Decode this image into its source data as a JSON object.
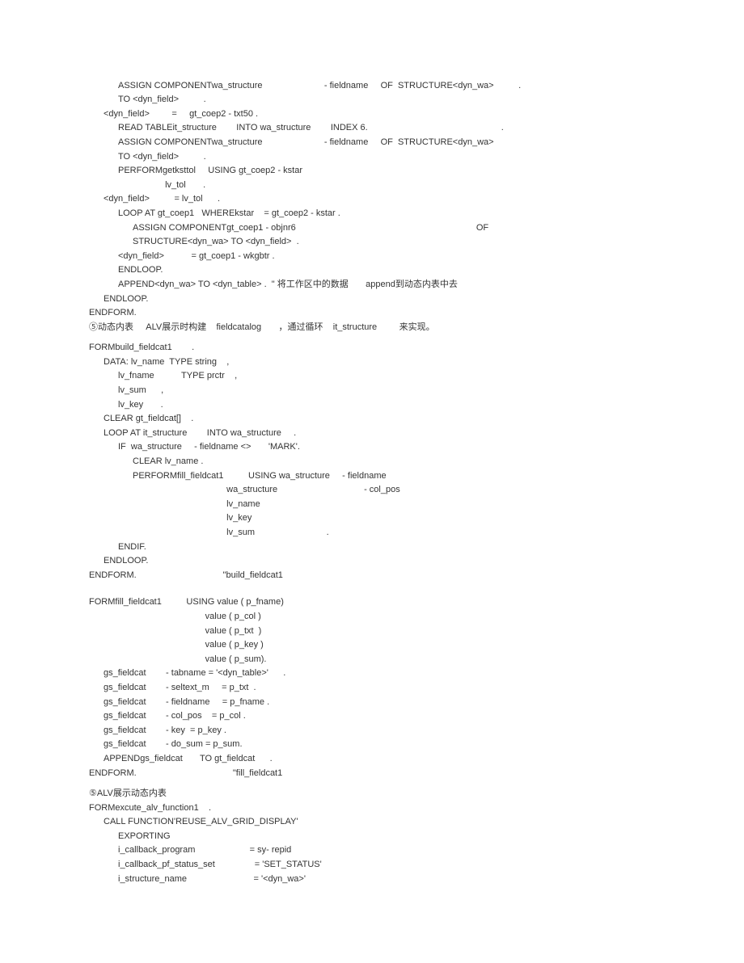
{
  "lines": [
    {
      "indent": 2,
      "text": "ASSIGN COMPONENTwa_structure                         - fieldname     OF  STRUCTURE<dyn_wa>          ."
    },
    {
      "indent": 2,
      "text": "TO <dyn_field>          ."
    },
    {
      "indent": 1,
      "text": "<dyn_field>         =     gt_coep2 - txt50 ."
    },
    {
      "indent": 2,
      "text": "READ TABLEit_structure        INTO wa_structure        INDEX 6.                                                      ."
    },
    {
      "indent": 2,
      "text": "ASSIGN COMPONENTwa_structure                         - fieldname     OF  STRUCTURE<dyn_wa>"
    },
    {
      "indent": 2,
      "text": "TO <dyn_field>          ."
    },
    {
      "indent": 2,
      "text": "PERFORMgetksttol     USING gt_coep2 - kstar"
    },
    {
      "indent": 2,
      "text": "                   lv_tol       ."
    },
    {
      "indent": 1,
      "text": "<dyn_field>          = lv_tol      ."
    },
    {
      "indent": 2,
      "text": "LOOP AT gt_coep1   WHEREkstar    = gt_coep2 - kstar ."
    },
    {
      "indent": 3,
      "text": "ASSIGN COMPONENTgt_coep1 - objnr6                                                                         OF"
    },
    {
      "indent": 3,
      "text": "STRUCTURE<dyn_wa> TO <dyn_field>  ."
    },
    {
      "indent": 2,
      "text": "<dyn_field>           = gt_coep1 - wkgbtr ."
    },
    {
      "indent": 2,
      "text": "ENDLOOP."
    },
    {
      "indent": 2,
      "text": "APPEND<dyn_wa> TO <dyn_table> .  \" 将工作区中的数据       append到动态内表中去"
    },
    {
      "indent": 1,
      "text": "ENDLOOP."
    },
    {
      "indent": 0,
      "text": "ENDFORM."
    },
    {
      "indent": 0,
      "text": "⑤动态内表     ALV展示时构建    fieldcatalog       ，通过循环    it_structure         来实现。"
    },
    {
      "spacer": true
    },
    {
      "indent": 0,
      "text": "FORMbuild_fieldcat1        ."
    },
    {
      "indent": 1,
      "text": "DATA: lv_name  TYPE string    ,"
    },
    {
      "indent": 2,
      "text": "lv_fname           TYPE prctr    ,"
    },
    {
      "indent": 2,
      "text": "lv_sum      ,"
    },
    {
      "indent": 2,
      "text": "lv_key       ."
    },
    {
      "indent": 1,
      "text": "CLEAR gt_fieldcat[]    ."
    },
    {
      "indent": 1,
      "text": "LOOP AT it_structure        INTO wa_structure     ."
    },
    {
      "indent": 2,
      "text": "IF  wa_structure     - fieldname <>       'MARK'."
    },
    {
      "indent": 3,
      "text": "CLEAR lv_name ."
    },
    {
      "indent": 3,
      "text": "PERFORMfill_fieldcat1          USING wa_structure     - fieldname"
    },
    {
      "indent": 3,
      "text": "                                      wa_structure                                   - col_pos"
    },
    {
      "indent": 3,
      "text": "                                      lv_name"
    },
    {
      "indent": 3,
      "text": "                                      lv_key"
    },
    {
      "indent": 3,
      "text": "                                      lv_sum                             ."
    },
    {
      "indent": 2,
      "text": "ENDIF."
    },
    {
      "indent": 1,
      "text": "ENDLOOP."
    },
    {
      "indent": 0,
      "text": "ENDFORM.                                   \"build_fieldcat1"
    },
    {
      "spacer": true
    },
    {
      "spacer": true
    },
    {
      "indent": 0,
      "text": "FORMfill_fieldcat1          USING value ( p_fname)"
    },
    {
      "indent": 0,
      "text": "                                               value ( p_col )"
    },
    {
      "indent": 0,
      "text": "                                               value ( p_txt  )"
    },
    {
      "indent": 0,
      "text": "                                               value ( p_key )"
    },
    {
      "indent": 0,
      "text": "                                               value ( p_sum)."
    },
    {
      "indent": 1,
      "text": "gs_fieldcat        - tabname = '<dyn_table>'      ."
    },
    {
      "indent": 1,
      "text": "gs_fieldcat        - seltext_m     = p_txt  ."
    },
    {
      "indent": 1,
      "text": "gs_fieldcat        - fieldname     = p_fname ."
    },
    {
      "indent": 1,
      "text": "gs_fieldcat        - col_pos    = p_col ."
    },
    {
      "indent": 1,
      "text": "gs_fieldcat        - key  = p_key ."
    },
    {
      "indent": 1,
      "text": "gs_fieldcat        - do_sum = p_sum."
    },
    {
      "indent": 1,
      "text": "APPENDgs_fieldcat       TO gt_fieldcat      ."
    },
    {
      "indent": 0,
      "text": "ENDFORM.                                       \"fill_fieldcat1"
    },
    {
      "spacer": true
    },
    {
      "indent": 0,
      "text": "⑤ALV展示动态内表"
    },
    {
      "indent": 0,
      "text": "FORMexcute_alv_function1    ."
    },
    {
      "indent": 1,
      "text": "CALL FUNCTION'REUSE_ALV_GRID_DISPLAY'"
    },
    {
      "indent": 2,
      "text": "EXPORTING"
    },
    {
      "indent": 2,
      "text": "i_callback_program                      = sy- repid"
    },
    {
      "indent": 2,
      "text": "i_callback_pf_status_set                = 'SET_STATUS'"
    },
    {
      "indent": 2,
      "text": "i_structure_name                           = '<dyn_wa>'"
    }
  ]
}
